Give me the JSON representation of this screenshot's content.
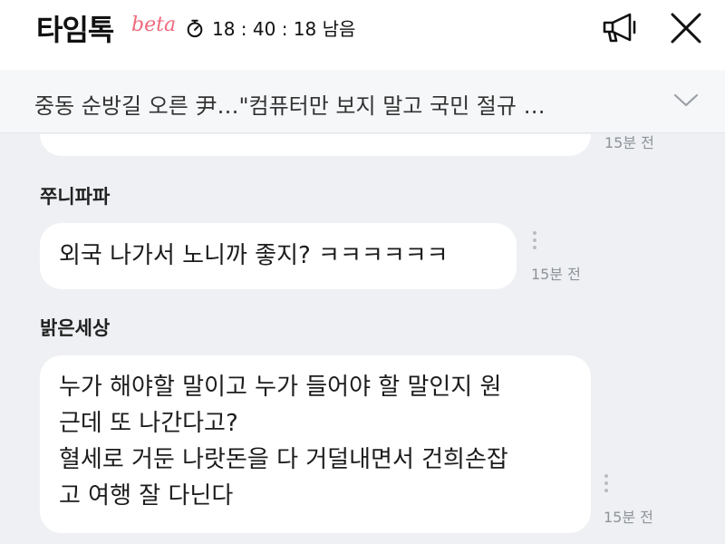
{
  "header": {
    "app_title": "타임톡",
    "beta_label": "beta",
    "timer_text": "18 : 40 : 18 남음"
  },
  "topic": {
    "text": "중동 순방길 오른 尹…\"컴퓨터만 보지 말고 국민 절규 …"
  },
  "messages": [
    {
      "nickname": "",
      "text": "",
      "time": "15분 전"
    },
    {
      "nickname": "쭈니파파",
      "text": "외국 나가서 노니까 좋지? ㅋㅋㅋㅋㅋㅋ",
      "time": "15분 전"
    },
    {
      "nickname": "밝은세상",
      "text": "누가 해야할 말이고 누가 들어야 할 말인지 원\n근데 또 나간다고?\n혈세로 거둔 나랏돈을 다 거덜내면서 건희손잡\n고 여행 잘 다닌다",
      "time": "15분 전"
    }
  ]
}
